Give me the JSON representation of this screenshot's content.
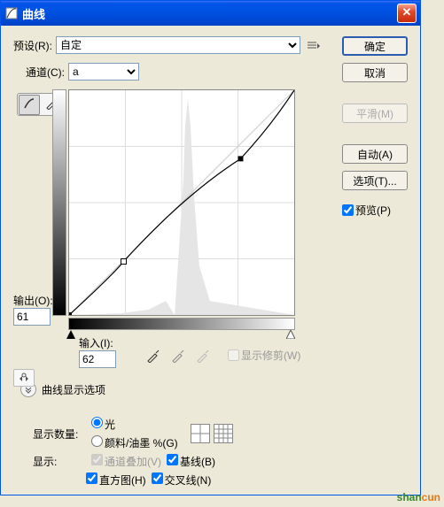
{
  "titlebar": {
    "title": "曲线"
  },
  "preset": {
    "label": "预设(R):",
    "value": "自定"
  },
  "channel": {
    "label": "通道(C):",
    "value": "a"
  },
  "output": {
    "label": "输出(O):",
    "value": "61"
  },
  "input": {
    "label": "输入(I):",
    "value": "62"
  },
  "clip": {
    "label": "显示修剪(W)"
  },
  "display_options": {
    "title": "曲线显示选项"
  },
  "amount": {
    "label": "显示数量:",
    "light": "光",
    "ink": "颜料/油墨 %(G)"
  },
  "show": {
    "label": "显示:",
    "channel_overlay": "通道叠加(V)",
    "baseline": "基线(B)",
    "histogram": "直方图(H)",
    "intersection": "交叉线(N)"
  },
  "buttons": {
    "ok": "确定",
    "cancel": "取消",
    "smooth": "平滑(M)",
    "auto": "自动(A)",
    "options": "选项(T)..."
  },
  "preview": {
    "label": "预览(P)",
    "checked": true
  },
  "chart_data": {
    "type": "curve",
    "xlabel": "输入",
    "ylabel": "输出",
    "xlim": [
      0,
      255
    ],
    "ylim": [
      0,
      255
    ],
    "points": [
      {
        "x": 0,
        "y": 0
      },
      {
        "x": 62,
        "y": 61
      },
      {
        "x": 195,
        "y": 178
      },
      {
        "x": 255,
        "y": 255
      }
    ],
    "histogram_peak_x": 140
  },
  "watermark": "shancun"
}
